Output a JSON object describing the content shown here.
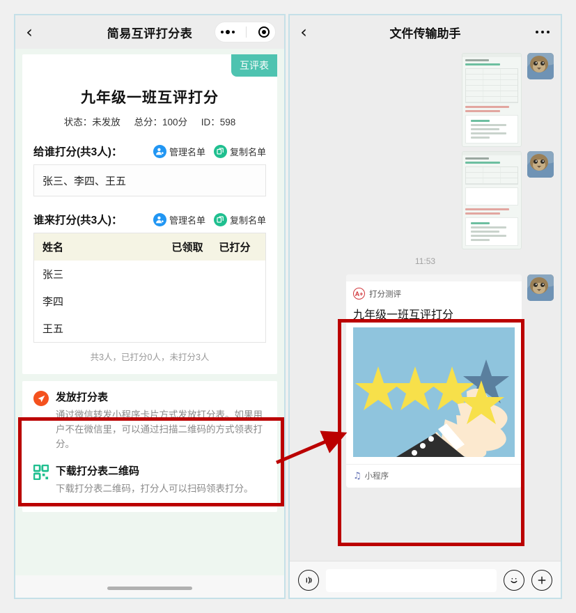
{
  "left_panel": {
    "header": {
      "back_icon": "chevron-left-icon",
      "title": "简易互评打分表",
      "capsule": {
        "more_icon": "more-dots-icon",
        "target_icon": "target-circle-icon"
      }
    },
    "badge": "互评表",
    "sheet": {
      "title": "九年级一班互评打分",
      "meta": {
        "status": "状态：未发放",
        "total": "总分：100分",
        "id": "ID：598"
      }
    },
    "section_rated": {
      "title": "给谁打分(共3人)：",
      "manage_label": "管理名单",
      "copy_label": "复制名单",
      "names": "张三、李四、王五"
    },
    "section_raters": {
      "title": "谁来打分(共3人)：",
      "manage_label": "管理名单",
      "copy_label": "复制名单",
      "table": {
        "headers": [
          "姓名",
          "已领取",
          "已打分"
        ],
        "rows": [
          {
            "name": "张三",
            "got": "",
            "scored": ""
          },
          {
            "name": "李四",
            "got": "",
            "scored": ""
          },
          {
            "name": "王五",
            "got": "",
            "scored": ""
          }
        ]
      },
      "summary": "共3人，已打分0人，未打分3人"
    },
    "actions": [
      {
        "icon": "send-paper-plane-icon",
        "title": "发放打分表",
        "desc": "通过微信转发小程序卡片方式发放打分表。如果用户不在微信里，可以通过扫描二维码的方式领表打分。"
      },
      {
        "icon": "qr-code-icon",
        "title": "下载打分表二维码",
        "desc": "下载打分表二维码，打分人可以扫码领表打分。"
      }
    ]
  },
  "right_panel": {
    "header": {
      "back_icon": "chevron-left-icon",
      "title": "文件传输助手",
      "more_icon": "more-dots-icon"
    },
    "timestamp": "11:53",
    "shared_card": {
      "brand_icon": "a-plus-badge-icon",
      "brand_name": "打分测评",
      "title": "九年级一班互评打分",
      "image_alt": "hand-picking-star-illustration",
      "footer_icon": "mini-program-icon",
      "footer_label": "小程序"
    },
    "input_bar": {
      "voice_icon": "voice-waves-icon",
      "input_value": "",
      "input_placeholder": "",
      "emoji_icon": "smiley-face-icon",
      "plus_icon": "plus-circle-icon"
    }
  },
  "annotations": {
    "highlight_color": "#bb0000",
    "left_highlight_target": "发放打分表",
    "right_highlight_target": "shared-mini-program-card",
    "arrow_icon": "arrow-right-icon"
  },
  "colors": {
    "page_bg": "#f0f0f0",
    "panel_border": "#c5e0e8",
    "badge_teal": "#4ec3b0",
    "manage_blue": "#2196f3",
    "copy_green": "#1fbf8f",
    "send_orange": "#f4511e",
    "qr_green": "#1fbf8f",
    "table_header_bg": "#f5f4e4",
    "card_image_bg": "#8fc4dd",
    "star_yellow": "#f5d800"
  }
}
